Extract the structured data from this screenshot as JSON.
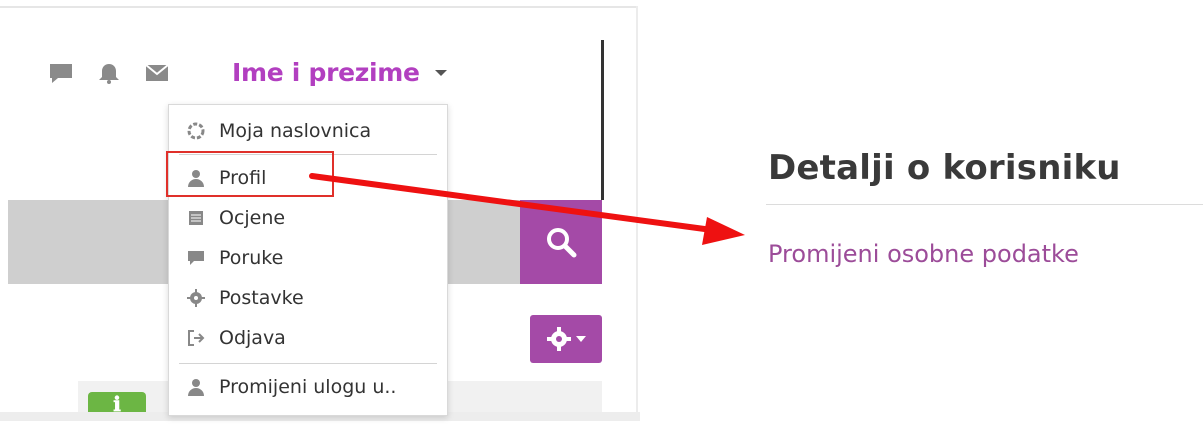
{
  "navbar": {
    "icons": [
      "chat-icon",
      "bell-icon",
      "envelope-icon"
    ],
    "user_name": "Ime i prezime"
  },
  "user_menu": {
    "items": [
      {
        "label": "Moja naslovnica",
        "icon": "dashboard-icon"
      },
      {
        "label": "Profil",
        "icon": "user-icon"
      },
      {
        "label": "Ocjene",
        "icon": "grades-icon"
      },
      {
        "label": "Poruke",
        "icon": "chat-icon"
      },
      {
        "label": "Postavke",
        "icon": "gear-icon"
      },
      {
        "label": "Odjava",
        "icon": "logout-icon"
      },
      {
        "label": "Promijeni ulogu u..",
        "icon": "user-icon"
      }
    ]
  },
  "detail_panel": {
    "title": "Detalji o korisniku",
    "edit_link": "Promijeni osobne podatke"
  },
  "colors": {
    "accent": "#a44aa7",
    "user_name": "#b23fc0",
    "highlight": "#e0302a",
    "link": "#9c4c99",
    "info_badge": "#6cb644"
  }
}
